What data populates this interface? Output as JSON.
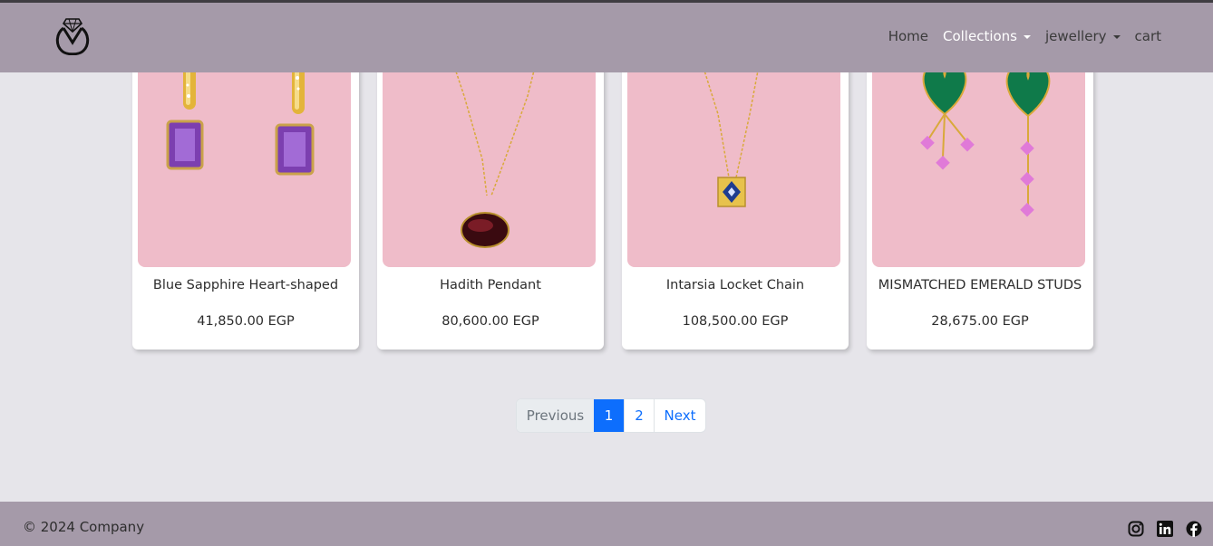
{
  "navbar": {
    "logo_icon": "diamond-ring-logo-icon",
    "links": [
      {
        "label": "Home"
      },
      {
        "label": "Collections"
      },
      {
        "label": "jewellery"
      },
      {
        "label": "cart"
      }
    ]
  },
  "products": [
    {
      "title": "Blue Sapphire Heart-shaped",
      "price": "41,850.00 EGP",
      "image_icon": "amethyst-drop-earrings-image"
    },
    {
      "title": "Hadith Pendant",
      "price": "80,600.00 EGP",
      "image_icon": "garnet-oval-pendant-necklace-image"
    },
    {
      "title": "Intarsia Locket Chain",
      "price": "108,500.00 EGP",
      "image_icon": "gold-locket-chain-image"
    },
    {
      "title": "MISMATCHED EMERALD STUDS",
      "price": "28,675.00 EGP",
      "image_icon": "emerald-heart-earrings-image"
    }
  ],
  "pagination": {
    "previous": "Previous",
    "pages": [
      "1",
      "2"
    ],
    "next": "Next",
    "active_page": "1"
  },
  "footer": {
    "copyright": "© 2024 Company",
    "social_icons": [
      "instagram-icon",
      "linkedin-icon",
      "facebook-icon"
    ]
  },
  "colors": {
    "navbar_bg": "#a59aa9",
    "page_bg": "#e6e5ea",
    "card_image_bg": "#efbcc9",
    "active_page": "#0d6efd"
  }
}
